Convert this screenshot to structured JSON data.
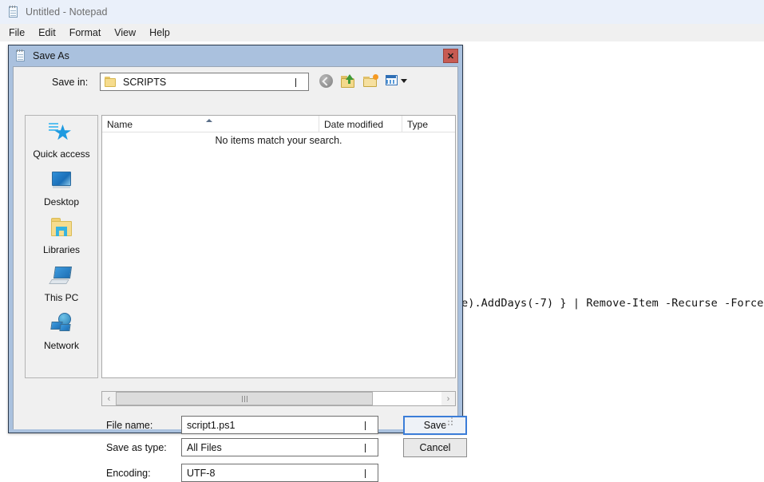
{
  "notepad": {
    "title": "Untitled - Notepad",
    "icon": "notepad-icon",
    "menu": [
      "File",
      "Edit",
      "Format",
      "View",
      "Help"
    ],
    "text": "e).AddDays(-7) } | Remove-Item -Recurse -Force"
  },
  "dialog": {
    "title": "Save As",
    "icon": "notepad-icon",
    "close_label": "✕",
    "save_in": {
      "label": "Save in:",
      "value": "SCRIPTS",
      "folder_icon": "folder-icon"
    },
    "toolbar": [
      {
        "name": "back-button",
        "icon": "back-arrow-icon"
      },
      {
        "name": "up-one-level-button",
        "icon": "up-folder-icon"
      },
      {
        "name": "new-folder-button",
        "icon": "new-folder-icon"
      },
      {
        "name": "views-button",
        "icon": "views-grid-icon"
      }
    ],
    "places": [
      {
        "label": "Quick access",
        "icon": "star-icon"
      },
      {
        "label": "Desktop",
        "icon": "monitor-icon"
      },
      {
        "label": "Libraries",
        "icon": "libraries-folder-icon"
      },
      {
        "label": "This PC",
        "icon": "computer-icon"
      },
      {
        "label": "Network",
        "icon": "network-globe-icon"
      }
    ],
    "file_list": {
      "columns": [
        "Name",
        "Date modified",
        "Type"
      ],
      "sort_column": "Name",
      "sort_direction": "ascending",
      "rows": [],
      "empty_message": "No items match your search."
    },
    "scrollbar": {
      "left_arrow": "‹",
      "right_arrow": "›"
    },
    "form": {
      "file_name_label": "File name:",
      "file_name_value": "script1.ps1",
      "save_as_type_label": "Save as type:",
      "save_as_type_value": "All Files",
      "encoding_label": "Encoding:",
      "encoding_value": "UTF-8"
    },
    "buttons": {
      "save_label": "Save",
      "cancel_label": "Cancel"
    },
    "colors": {
      "titlebar": "#aac1de",
      "close_button": "#c75b53",
      "focus_border": "#3b7dd8"
    }
  }
}
